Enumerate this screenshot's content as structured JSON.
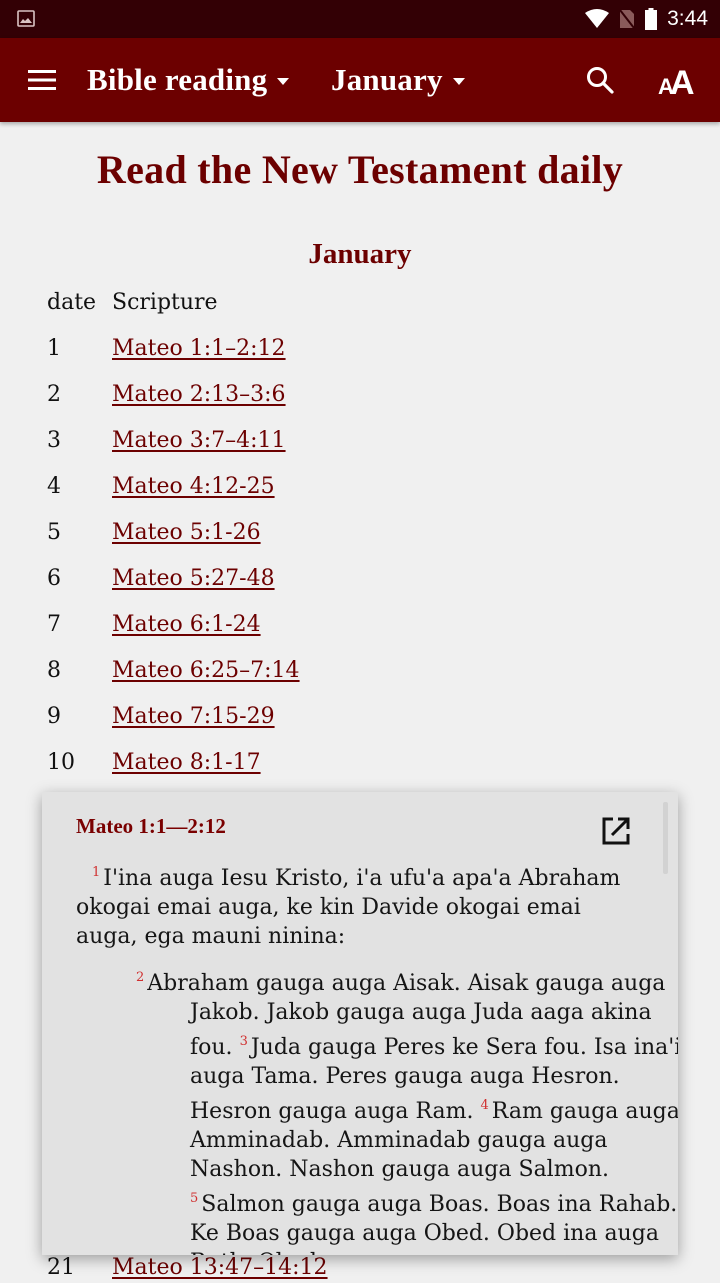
{
  "status_bar": {
    "left_icon": "image-icon",
    "icons": [
      "wifi-icon",
      "no-sim-icon",
      "battery-icon"
    ],
    "time": "3:44"
  },
  "app_bar": {
    "menu_icon": "hamburger-menu-icon",
    "book_dropdown": "Bible reading",
    "month_dropdown": "January",
    "search_icon": "search-icon",
    "font_size_icon": "font-size-icon"
  },
  "page": {
    "title": "Read the New Testament daily",
    "month_heading": "January",
    "table": {
      "headers": {
        "date": "date",
        "scripture": "Scripture"
      },
      "rows": [
        {
          "date": "1",
          "scripture": "Mateo 1:1–2:12"
        },
        {
          "date": "2",
          "scripture": "Mateo 2:13–3:6"
        },
        {
          "date": "3",
          "scripture": "Mateo 3:7–4:11"
        },
        {
          "date": "4",
          "scripture": "Mateo 4:12-25"
        },
        {
          "date": "5",
          "scripture": "Mateo 5:1-26"
        },
        {
          "date": "6",
          "scripture": "Mateo 5:27-48"
        },
        {
          "date": "7",
          "scripture": "Mateo 6:1-24"
        },
        {
          "date": "8",
          "scripture": "Mateo 6:25–7:14"
        },
        {
          "date": "9",
          "scripture": "Mateo 7:15-29"
        },
        {
          "date": "10",
          "scripture": "Mateo 8:1-17"
        },
        {
          "date": "21",
          "scripture": "Mateo 13:47–14:12"
        }
      ]
    }
  },
  "popup": {
    "title": "Mateo 1:1—2:12",
    "open_icon": "open-external-icon",
    "verses": [
      {
        "num": "1",
        "text": "I'ina auga Iesu Kristo, i'a ufu'a apa'a Abraham okogai emai auga, ke kin Davide okogai emai auga, ega mauni ninina:"
      },
      {
        "num": "2",
        "text": "Abraham gauga auga Aisak. Aisak gauga auga Jakob. Jakob gauga auga Juda aaga akina fou."
      },
      {
        "num": "3",
        "text": "Juda gauga Peres ke Sera fou. Isa ina'i auga Tama. Peres gauga auga Hesron. Hesron gauga auga Ram."
      },
      {
        "num": "4",
        "text": "Ram gauga auga Amminadab. Amminadab gauga auga Nashon. Nashon gauga auga Salmon."
      },
      {
        "num": "5",
        "text": "Salmon gauga auga Boas. Boas ina Rahab. Ke Boas gauga auga Obed. Obed ina auga Ruth. Obed"
      }
    ]
  }
}
